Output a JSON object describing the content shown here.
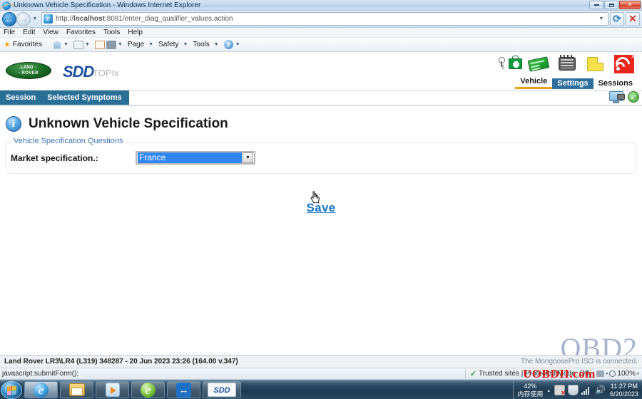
{
  "window": {
    "title": "Unknown Vehicle Specification - Windows Internet Explorer",
    "minimize_label": "Minimize",
    "restore_label": "Restore",
    "close_label": "Close"
  },
  "browser": {
    "back_label": "Back",
    "forward_label": "Forward",
    "url_prefix": "http://",
    "url_host": "localhost",
    "url_rest": ":8081/enter_diag_qualifier_values.action",
    "refresh_label": "Refresh",
    "stop_label": "Stop",
    "menu": [
      "File",
      "Edit",
      "View",
      "Favorites",
      "Tools",
      "Help"
    ],
    "command_bar": {
      "favorites": "Favorites",
      "page": "Page",
      "safety": "Safety",
      "tools": "Tools",
      "help": "?"
    }
  },
  "app": {
    "logo_line1": "LAND -",
    "logo_line2": "- ROVER",
    "product": "SDD",
    "topix": "TOPIx",
    "header_icons": [
      {
        "name": "vehicle-icon"
      },
      {
        "name": "settings-card-icon"
      },
      {
        "name": "sessions-book-icon"
      },
      {
        "name": "notes-icon"
      },
      {
        "name": "rss-icon"
      }
    ],
    "tabs": [
      {
        "label": "Vehicle",
        "state": "active"
      },
      {
        "label": "Settings",
        "state": "selected"
      },
      {
        "label": "Sessions",
        "state": "plain"
      }
    ],
    "session_bar": [
      "Session",
      "Selected Symptoms"
    ]
  },
  "content": {
    "page_title": "Unknown Vehicle Specification",
    "info_glyph": "i",
    "fieldset_legend": "Vehicle Specification Questions",
    "field_label": "Market specification.:",
    "field_value": "France",
    "dropdown_arrow": "▼",
    "save_label": "Save"
  },
  "watermark": {
    "brand": "OBD2",
    "site": "UOBDII.com"
  },
  "footer": {
    "vehicle_info": "Land Rover LR3\\LR4 (L319) 348287 - 20 Jun 2023 23:26 (164.00 v.347)",
    "connection_status": "The MongoosePro ISO is connected."
  },
  "status_bar": {
    "link_target": "javascript:submitForm();",
    "zone_check": "✓",
    "zone_text": "Trusted sites | Protected Mode: Off",
    "zoom_level": "100%",
    "zoom_caret": "▾"
  },
  "taskbar": {
    "start_label": "Start",
    "items": [
      {
        "name": "taskbar-internet-explorer",
        "label": "Internet Explorer"
      },
      {
        "name": "taskbar-windows-explorer",
        "label": "Windows Explorer"
      },
      {
        "name": "taskbar-media-player",
        "label": "Windows Media Player"
      },
      {
        "name": "taskbar-browser-green",
        "label": "Browser"
      },
      {
        "name": "taskbar-teamviewer",
        "label": "TeamViewer"
      },
      {
        "name": "taskbar-sdd",
        "label": "SDD"
      }
    ],
    "tray": {
      "memory_percent": "42%",
      "memory_label": "内存使用",
      "show_hidden_caret": "▴",
      "time": "11:27 PM",
      "date": "6/20/2023"
    }
  },
  "colors": {
    "sdd_blue": "#1b4fa0",
    "session_bar": "#2a6f96",
    "accent_orange": "#e8a020",
    "select_highlight": "#2f86f0",
    "link_blue": "#1677c4"
  }
}
